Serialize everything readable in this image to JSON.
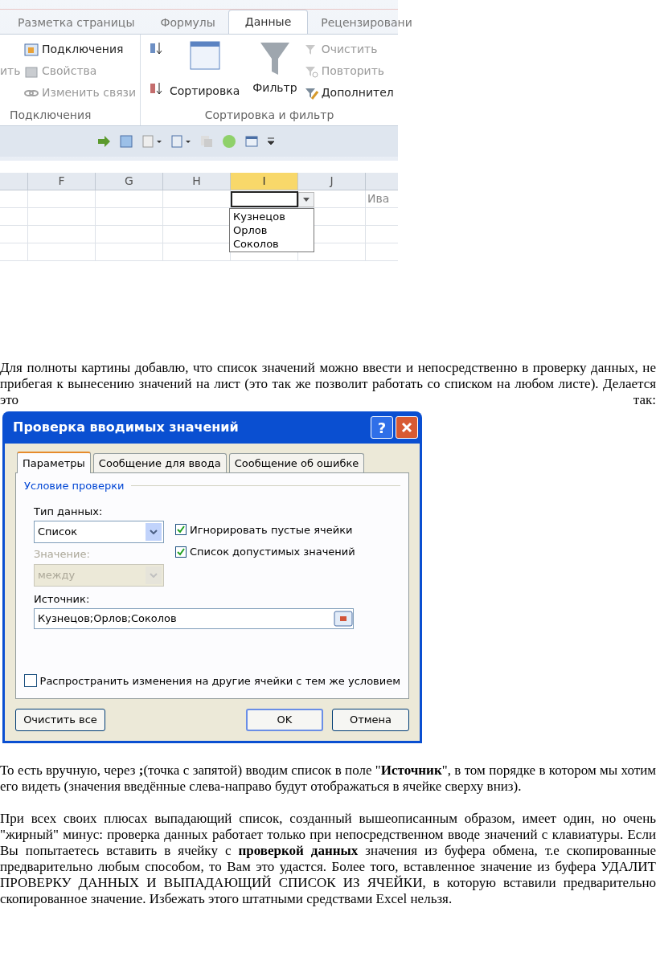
{
  "ribbon": {
    "tabs": [
      {
        "label": "Разметка страницы",
        "selected": false
      },
      {
        "label": "Формулы",
        "selected": false
      },
      {
        "label": "Данные",
        "selected": true
      },
      {
        "label": "Рецензировани",
        "selected": false
      }
    ],
    "connections": {
      "cut_label": "ить",
      "title": "Подключения",
      "items": [
        {
          "label": "Подключения",
          "disabled": false
        },
        {
          "label": "Свойства",
          "disabled": true
        },
        {
          "label": "Изменить связи",
          "disabled": true
        }
      ]
    },
    "sort_filter": {
      "sort_label": "Сортировка",
      "filter_label": "Фильтр",
      "title": "Сортировка и фильтр",
      "items": [
        {
          "label": "Очистить",
          "disabled": true
        },
        {
          "label": "Повторить",
          "disabled": true
        },
        {
          "label": "Дополнител",
          "disabled": false
        }
      ]
    }
  },
  "sheet": {
    "columns": [
      {
        "label": "F",
        "selected": false
      },
      {
        "label": "G",
        "selected": false
      },
      {
        "label": "H",
        "selected": false
      },
      {
        "label": "I",
        "selected": true
      },
      {
        "label": "J",
        "selected": false
      }
    ],
    "cut_cell": "Ива",
    "dropdown_options": [
      "Кузнецов",
      "Орлов",
      "Соколов"
    ]
  },
  "intro_paragraph": "Для полноты картины добавлю, что список значений можно ввести и непосредственно в проверку данных, не прибегая к вынесению значений на лист (это так же позволит работать со списком на любом листе). Делается это так:",
  "dialog": {
    "title": "Проверка вводимых значений",
    "help_label": "?",
    "tabs": [
      {
        "label": "Параметры",
        "selected": true
      },
      {
        "label": "Сообщение для ввода",
        "selected": false
      },
      {
        "label": "Сообщение об ошибке",
        "selected": false
      }
    ],
    "section_title": "Условие проверки",
    "data_type": {
      "label": "Тип данных:",
      "value": "Список",
      "disabled": false
    },
    "checkboxes": [
      {
        "label": "Игнорировать пустые ячейки",
        "checked": true
      },
      {
        "label": "Список допустимых значений",
        "checked": true
      }
    ],
    "value_field": {
      "label": "Значение:",
      "value": "между",
      "disabled": true
    },
    "source": {
      "label": "Источник:",
      "value": "Кузнецов;Орлов;Соколов"
    },
    "apply_all": {
      "label": "Распространить изменения на другие ячейки с тем же условием",
      "checked": false
    },
    "buttons": [
      {
        "label": "Очистить все",
        "default": false
      },
      {
        "label": "OK",
        "default": true
      },
      {
        "label": "Отмена",
        "default": false
      }
    ]
  },
  "paragraphs": [
    "То есть вручную, через **;**(точка с запятой) вводим список в поле \"**Источник**\", в том порядке в котором мы хотим его видеть (значения введённые слева-направо будут отображаться в ячейке сверху вниз).",
    "При всех своих плюсах выпадающий список, созданный вышеописанным образом, имеет один, но очень \"жирный\" минус: проверка данных работает только при непосредственном вводе значений с клавиатуры. Если Вы попытаетесь вставить в ячейку с **проверкой данных** значения из буфера обмена, т.е скопированные предварительно любым способом, то Вам это удастся. Более того, вставленное значение из буфера УДАЛИТ ПРОВЕРКУ ДАННЫХ И ВЫПАДАЮЩИЙ СПИСОК ИЗ ЯЧЕЙКИ, в которую вставили предварительно скопированное значение. Избежать этого штатными средствами Excel нельзя."
  ]
}
